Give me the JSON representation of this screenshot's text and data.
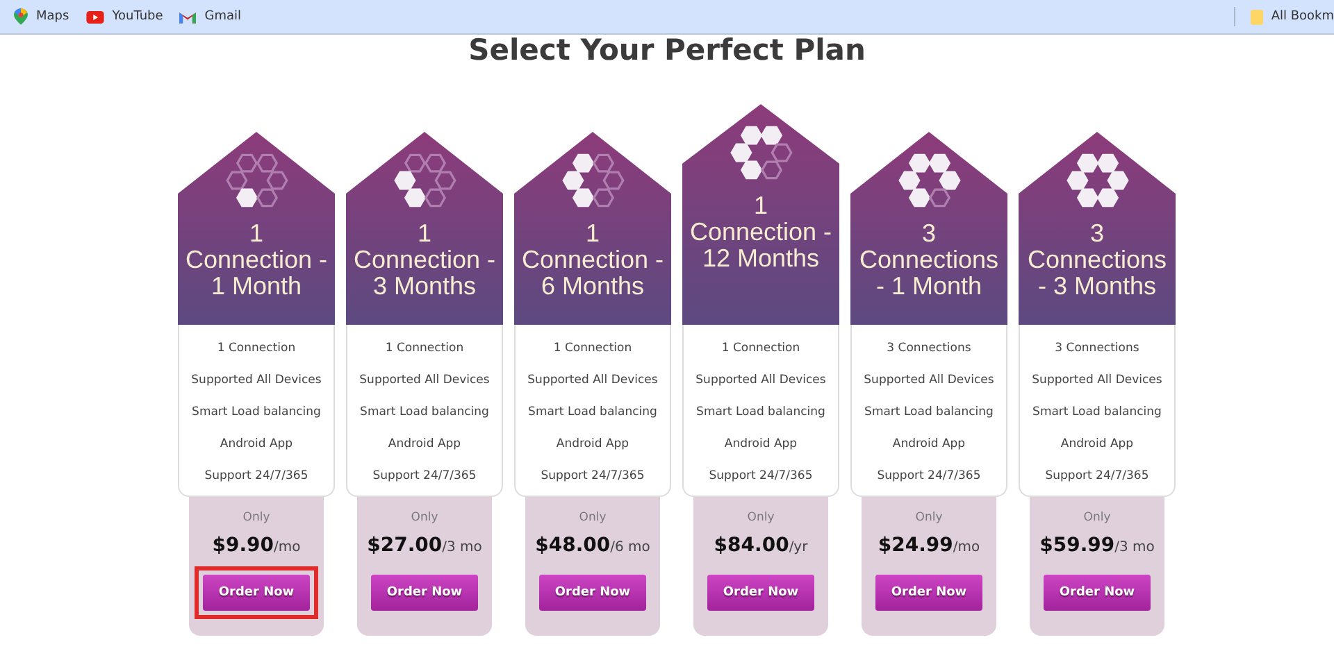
{
  "bookmarks_bar": {
    "items": [
      {
        "kind": "maps",
        "label": "Maps"
      },
      {
        "kind": "youtube",
        "label": "YouTube"
      },
      {
        "kind": "gmail",
        "label": "Gmail"
      }
    ],
    "all_bookmarks": "All Bookm"
  },
  "heading": "Select Your Perfect Plan",
  "plans": [
    {
      "title": "1 Connection - 1 Month",
      "featured": false,
      "hexes": [
        {
          "filled": false
        },
        {
          "filled": false
        },
        {
          "filled": false
        },
        {
          "filled": false
        },
        {
          "filled": true
        },
        {
          "filled": false
        }
      ],
      "features": [
        "1 Connection",
        "Supported All Devices",
        "Smart Load balancing",
        "Android App",
        "Support 24/7/365"
      ],
      "price_label": "Only",
      "price": "$9.90",
      "period": "/mo",
      "button": "Order Now",
      "highlighted": true
    },
    {
      "title": "1 Connection - 3 Months",
      "featured": false,
      "hexes": [
        {
          "filled": false
        },
        {
          "filled": false
        },
        {
          "filled": true
        },
        {
          "filled": false
        },
        {
          "filled": true
        },
        {
          "filled": false
        }
      ],
      "features": [
        "1 Connection",
        "Supported All Devices",
        "Smart Load balancing",
        "Android App",
        "Support 24/7/365"
      ],
      "price_label": "Only",
      "price": "$27.00",
      "period": "/3 mo",
      "button": "Order Now",
      "highlighted": false
    },
    {
      "title": "1 Connection - 6 Months",
      "featured": false,
      "hexes": [
        {
          "filled": true
        },
        {
          "filled": false
        },
        {
          "filled": true
        },
        {
          "filled": false
        },
        {
          "filled": true
        },
        {
          "filled": false
        }
      ],
      "features": [
        "1 Connection",
        "Supported All Devices",
        "Smart Load balancing",
        "Android App",
        "Support 24/7/365"
      ],
      "price_label": "Only",
      "price": "$48.00",
      "period": "/6 mo",
      "button": "Order Now",
      "highlighted": false
    },
    {
      "title": "1 Connection - 12 Months",
      "featured": true,
      "hexes": [
        {
          "filled": true
        },
        {
          "filled": true
        },
        {
          "filled": true
        },
        {
          "filled": false
        },
        {
          "filled": true
        },
        {
          "filled": false
        }
      ],
      "features": [
        "1 Connection",
        "Supported All Devices",
        "Smart Load balancing",
        "Android App",
        "Support 24/7/365"
      ],
      "price_label": "Only",
      "price": "$84.00",
      "period": "/yr",
      "button": "Order Now",
      "highlighted": false
    },
    {
      "title": "3 Connections - 1 Month",
      "featured": false,
      "hexes": [
        {
          "filled": true
        },
        {
          "filled": true
        },
        {
          "filled": true
        },
        {
          "filled": true
        },
        {
          "filled": true
        },
        {
          "filled": false
        }
      ],
      "features": [
        "3 Connections",
        "Supported All Devices",
        "Smart Load balancing",
        "Android App",
        "Support 24/7/365"
      ],
      "price_label": "Only",
      "price": "$24.99",
      "period": "/mo",
      "button": "Order Now",
      "highlighted": false
    },
    {
      "title": "3 Connections - 3 Months",
      "featured": false,
      "hexes": [
        {
          "filled": true
        },
        {
          "filled": true
        },
        {
          "filled": true
        },
        {
          "filled": true
        },
        {
          "filled": true
        },
        {
          "filled": true
        }
      ],
      "features": [
        "3 Connections",
        "Supported All Devices",
        "Smart Load balancing",
        "Android App",
        "Support 24/7/365"
      ],
      "price_label": "Only",
      "price": "$59.99",
      "period": "/3 mo",
      "button": "Order Now",
      "highlighted": false
    }
  ]
}
